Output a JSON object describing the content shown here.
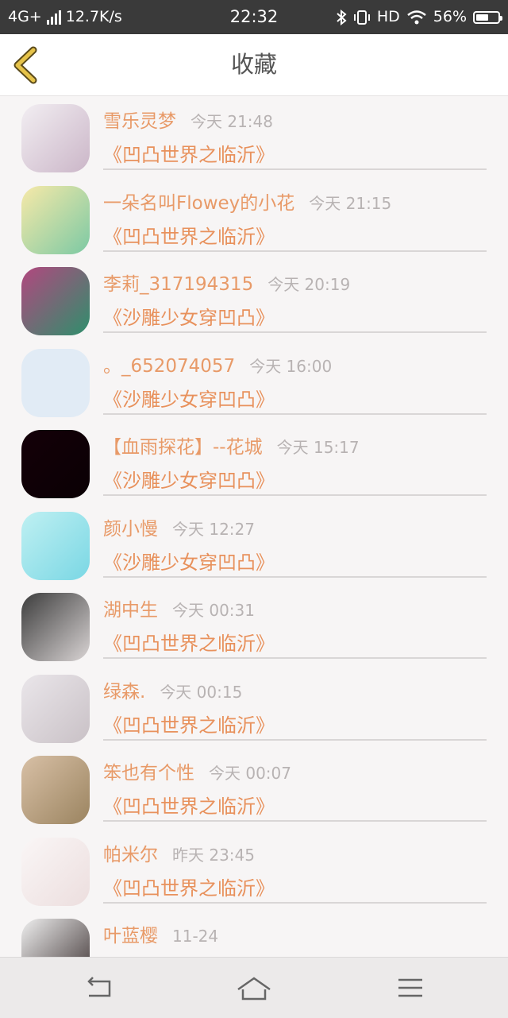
{
  "status_bar": {
    "network": "4G+",
    "speed": "12.7K/s",
    "time": "22:32",
    "hd": "HD",
    "battery": "56%",
    "battery_level": 0.56
  },
  "header": {
    "title": "收藏",
    "back_icon": "chevron-left-icon"
  },
  "items": [
    {
      "name": "雪乐灵梦",
      "time": "今天 21:48",
      "book": "《凹凸世界之临沂》",
      "avatar_colors": [
        "#f2eef2",
        "#cbb6c8"
      ]
    },
    {
      "name": "一朵名叫Flowey的小花",
      "time": "今天 21:15",
      "book": "《凹凸世界之临沂》",
      "avatar_colors": [
        "#f7e9a8",
        "#7cc9a4"
      ]
    },
    {
      "name": "李莉_317194315",
      "time": "今天 20:19",
      "book": "《沙雕少女穿凹凸》",
      "avatar_colors": [
        "#b2477f",
        "#2f8f6c"
      ]
    },
    {
      "name": "。_652074057",
      "time": "今天 16:00",
      "book": "《沙雕少女穿凹凸》",
      "avatar_colors": [
        "#e1ebf5",
        "#e1ebf5"
      ]
    },
    {
      "name": "【血雨探花】--花城",
      "time": "今天 15:17",
      "book": "《沙雕少女穿凹凸》",
      "avatar_colors": [
        "#140008",
        "#0a0004"
      ]
    },
    {
      "name": "颜小慢",
      "time": "今天 12:27",
      "book": "《沙雕少女穿凹凸》",
      "avatar_colors": [
        "#bff0f2",
        "#7ad7e4"
      ]
    },
    {
      "name": "湖中生",
      "time": "今天 00:31",
      "book": "《凹凸世界之临沂》",
      "avatar_colors": [
        "#3c3c3c",
        "#d9d4d4"
      ]
    },
    {
      "name": "绿森.",
      "time": "今天 00:15",
      "book": "《凹凸世界之临沂》",
      "avatar_colors": [
        "#eae6ea",
        "#c9c1c6"
      ]
    },
    {
      "name": "笨也有个性",
      "time": "今天 00:07",
      "book": "《凹凸世界之临沂》",
      "avatar_colors": [
        "#d8c0a6",
        "#9b8460"
      ]
    },
    {
      "name": "帕米尔",
      "time": "昨天 23:45",
      "book": "《凹凸世界之临沂》",
      "avatar_colors": [
        "#faf6f6",
        "#ecdede"
      ]
    },
    {
      "name": "叶蓝樱",
      "time": "11-24",
      "book": "",
      "avatar_colors": [
        "#efefef",
        "#3a2f2f"
      ]
    }
  ],
  "nav_bar": {
    "back_icon": "back-arrow-icon",
    "home_icon": "home-icon",
    "menu_icon": "menu-icon"
  },
  "colors": {
    "accent": "#e8915c",
    "status_bar": "#3a3a3a",
    "back_chevron": "#e6c34a"
  }
}
